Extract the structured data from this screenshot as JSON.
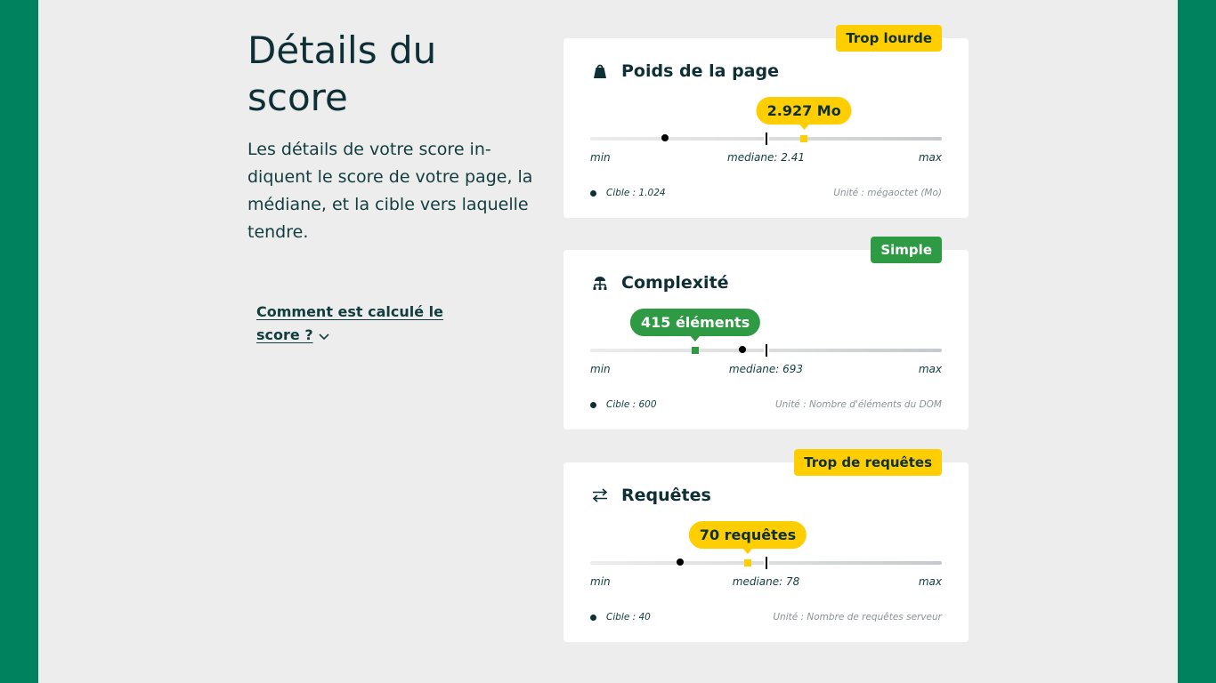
{
  "section": {
    "title": "Détails du score",
    "description": "Les détails de votre score in-diquent le score de votre page, la médiane, et la cible vers laquelle tendre.",
    "how_link": "Comment est calculé le score ?"
  },
  "colors": {
    "green_bg": "#00825f",
    "yellow": "#fece00",
    "green": "#2e9a44"
  },
  "cards": [
    {
      "icon": "weight-icon",
      "title": "Poids de la page",
      "badge": "Trop lourde",
      "badge_color": "yellow",
      "score_label": "2.927 Mo",
      "score_fraction": 0.608,
      "target_fraction": 0.213,
      "median_label": "mediane: 2.41",
      "median_fraction": 0.5,
      "min_label": "min",
      "max_label": "max",
      "target_label": "Cible : 1.024",
      "unit_label": "Unité : mégaoctet (Mo)"
    },
    {
      "icon": "sitemap-icon",
      "title": "Complexité",
      "badge": "Simple",
      "badge_color": "green",
      "score_label": "415 éléments",
      "score_fraction": 0.299,
      "target_fraction": 0.433,
      "median_label": "mediane: 693",
      "median_fraction": 0.5,
      "min_label": "min",
      "max_label": "max",
      "target_label": "Cible : 600",
      "unit_label": "Unité : Nombre d'éléments du DOM"
    },
    {
      "icon": "swap-icon",
      "title": "Requêtes",
      "badge": "Trop de requêtes",
      "badge_color": "yellow",
      "score_label": "70 requêtes",
      "score_fraction": 0.448,
      "target_fraction": 0.256,
      "median_label": "mediane: 78",
      "median_fraction": 0.5,
      "min_label": "min",
      "max_label": "max",
      "target_label": "Cible : 40",
      "unit_label": "Unité : Nombre de requêtes serveur"
    }
  ]
}
